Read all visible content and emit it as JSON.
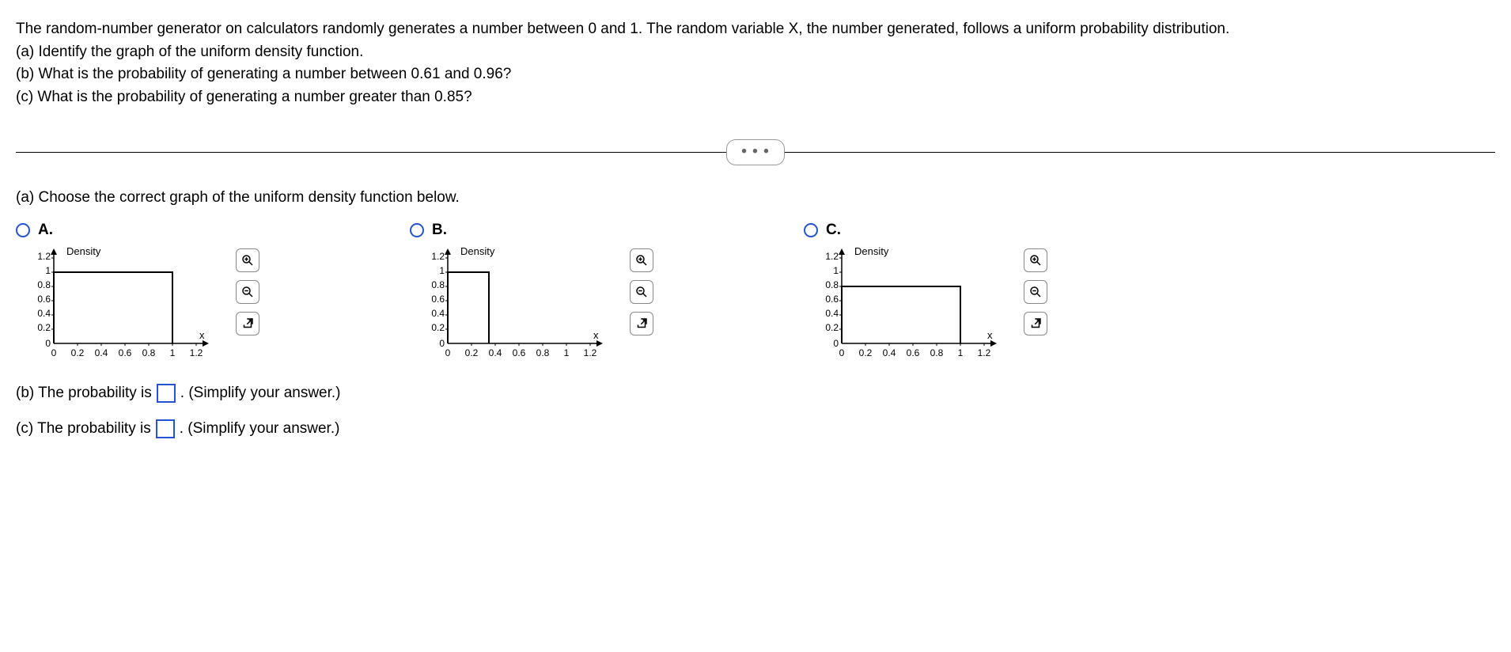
{
  "question": {
    "intro": "The random-number generator on calculators randomly generates a number between 0 and 1. The random variable X, the number generated, follows a uniform probability distribution.",
    "a": "(a) Identify the graph of the uniform density function.",
    "b": "(b) What is the probability of generating a number between 0.61 and 0.96?",
    "c": "(c) What is the probability of generating a number greater than 0.85?"
  },
  "divider_dots": "• • •",
  "partA": {
    "prompt": "(a) Choose the correct graph of the uniform density function below.",
    "options": [
      {
        "label": "A."
      },
      {
        "label": "B."
      },
      {
        "label": "C."
      }
    ],
    "axis": {
      "ylabel": "Density",
      "xlabel": "x",
      "yticks": [
        "1.2",
        "1",
        "0.8",
        "0.6",
        "0.4",
        "0.2",
        "0"
      ],
      "xticks": [
        "0",
        "0.2",
        "0.4",
        "0.6",
        "0.8",
        "1",
        "1.2"
      ]
    }
  },
  "partB": {
    "prefix": "(b) The probability is",
    "hint": ". (Simplify your answer.)"
  },
  "partC": {
    "prefix": "(c) The probability is",
    "hint": ". (Simplify your answer.)"
  },
  "chart_data": [
    {
      "type": "line",
      "title": "A",
      "xlabel": "x",
      "ylabel": "Density",
      "xlim": [
        0,
        1.2
      ],
      "ylim": [
        0,
        1.2
      ],
      "series": [
        {
          "name": "A",
          "x": [
            0,
            0,
            1,
            1
          ],
          "y": [
            0,
            1,
            1,
            0
          ]
        }
      ]
    },
    {
      "type": "line",
      "title": "B",
      "xlabel": "x",
      "ylabel": "Density",
      "xlim": [
        0,
        1.2
      ],
      "ylim": [
        0,
        1.2
      ],
      "series": [
        {
          "name": "B",
          "x": [
            0,
            0,
            0.35,
            0.35
          ],
          "y": [
            0,
            1,
            1,
            0
          ]
        }
      ]
    },
    {
      "type": "line",
      "title": "C",
      "xlabel": "x",
      "ylabel": "Density",
      "xlim": [
        0,
        1.2
      ],
      "ylim": [
        0,
        1.2
      ],
      "series": [
        {
          "name": "C",
          "x": [
            0,
            0,
            1,
            1
          ],
          "y": [
            0,
            0.8,
            0.8,
            0
          ]
        }
      ]
    }
  ]
}
